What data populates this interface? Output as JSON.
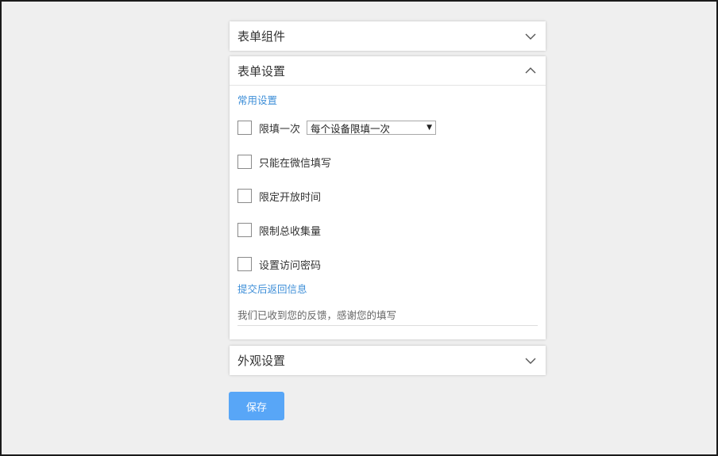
{
  "panels": {
    "form_components": {
      "title": "表单组件",
      "expanded": false
    },
    "form_settings": {
      "title": "表单设置",
      "expanded": true,
      "common_settings_label": "常用设置",
      "options": [
        {
          "label": "限填一次",
          "checked": false
        },
        {
          "label": "只能在微信填写",
          "checked": false
        },
        {
          "label": "限定开放时间",
          "checked": false
        },
        {
          "label": "限制总收集量",
          "checked": false
        },
        {
          "label": "设置访问密码",
          "checked": false
        }
      ],
      "limit_select": {
        "value": "每个设备限填一次"
      },
      "return_info_label": "提交后返回信息",
      "return_message": "我们已收到您的反馈，感谢您的填写"
    },
    "appearance": {
      "title": "外观设置",
      "expanded": false
    }
  },
  "save_button": {
    "label": "保存"
  },
  "colors": {
    "accent_link": "#3f8fd8",
    "primary_button": "#58a6f7",
    "background": "#efefef"
  },
  "icons": {
    "collapsed": "chevron-down-icon",
    "expanded": "chevron-up-icon",
    "select_arrow": "dropdown-triangle-icon"
  }
}
